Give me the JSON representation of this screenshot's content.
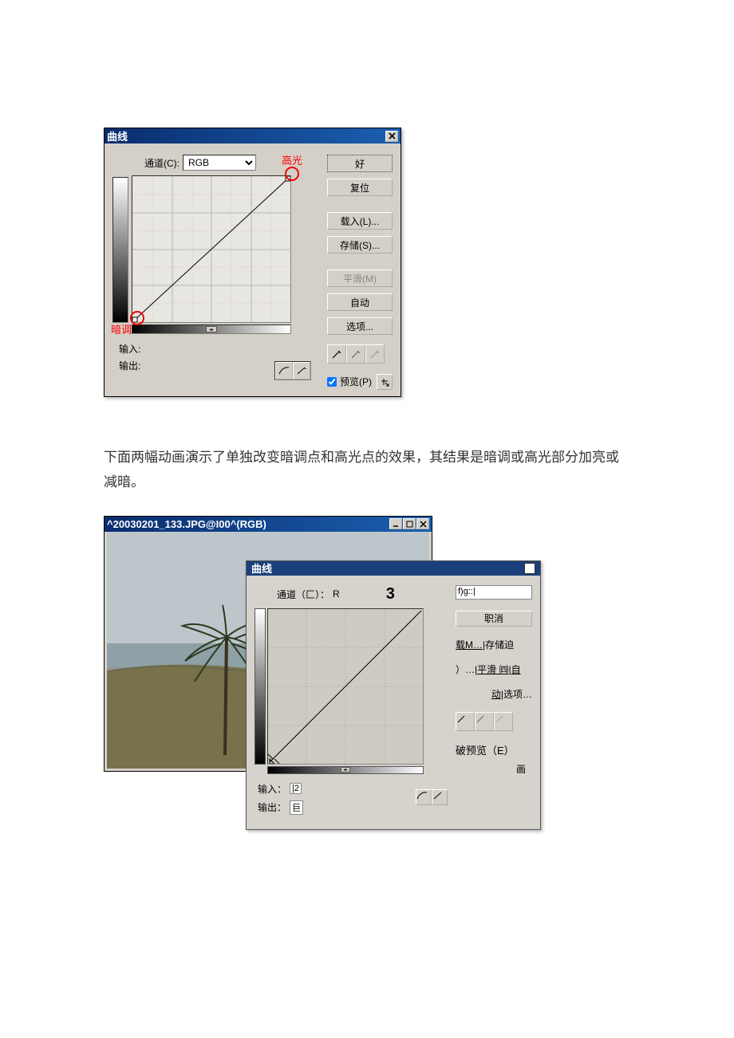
{
  "dialog1": {
    "title": "曲线",
    "channel_label": "通道(C):",
    "channel_value": "RGB",
    "highlight_label": "高光",
    "shadow_label": "暗调",
    "input_label": "输入:",
    "output_label": "输出:",
    "buttons": {
      "ok": "好",
      "reset": "复位",
      "load": "载入(L)...",
      "save": "存储(S)...",
      "smooth": "平滑(M)",
      "auto": "自动",
      "options": "选项..."
    },
    "preview_label": "预览(P)"
  },
  "body_text": "下面两幅动画演示了单独改变暗调点和高光点的效果，其结果是暗调或高光部分加亮或减暗。",
  "window2": {
    "title": "^20030201_133.JPG@I00^(RGB)"
  },
  "dialog2": {
    "title": "曲线",
    "channel_label": "通道（匚）：",
    "channel_value": "R",
    "num": "3",
    "input_label": "输入：",
    "input_value": "|2",
    "output_label": "输出：",
    "output_value": "巨",
    "top_box": "f)g::|",
    "cancel": "职消",
    "load": "载M…",
    "save": "|存储迫",
    "line2_prefix": "）…",
    "smooth": "平滑 ㈣",
    "line2_suffix": "|自",
    "line3a": "动|",
    "options": "选项…",
    "preview": "破预览（E）",
    "hua": "画"
  }
}
